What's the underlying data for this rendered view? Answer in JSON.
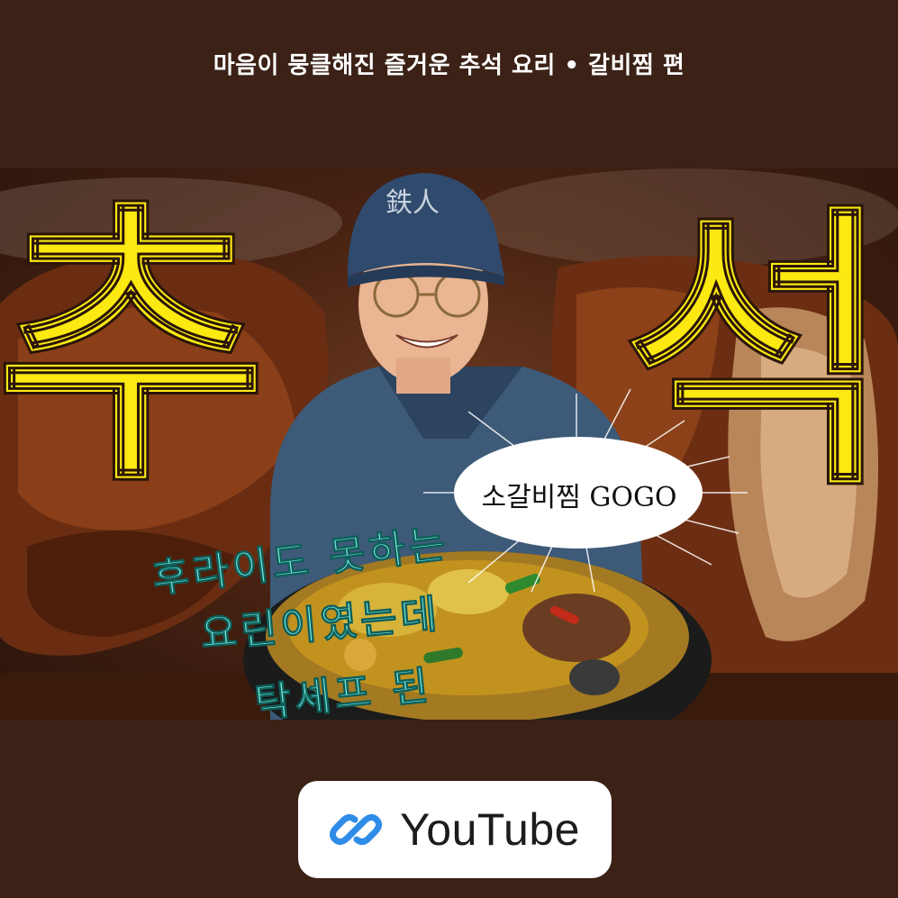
{
  "caption": "마음이 뭉클해진 즐거운 추석 요리 • 갈비찜 편",
  "thumbnail": {
    "big_left": "추",
    "big_right": "석",
    "cap_logo": "鉄人",
    "bubble": "소갈비찜 GOGO",
    "script_lines": [
      "후라이도 못하는",
      "요린이였는데",
      "탁셰프 된"
    ]
  },
  "link_card": {
    "icon": "link-icon",
    "label": "YouTube"
  },
  "colors": {
    "background": "#3b2116",
    "title_yellow": "#fbe911",
    "script_mint": "#7fe9de",
    "link_blue": "#2f8ce8"
  }
}
